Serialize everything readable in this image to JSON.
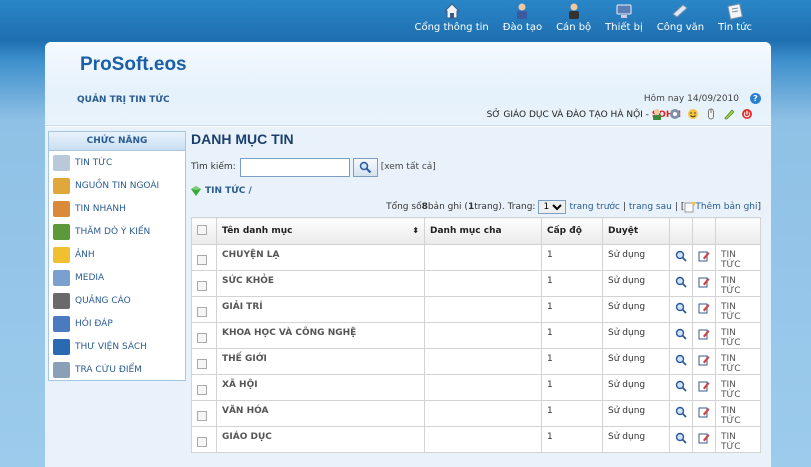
{
  "topnav": [
    {
      "label": "Cổng thông tin",
      "icon": "home-icon",
      "color": "#e8eef6"
    },
    {
      "label": "Đào tạo",
      "icon": "student-icon",
      "color": "#3d5aa0"
    },
    {
      "label": "Cán bộ",
      "icon": "staff-icon",
      "color": "#333333"
    },
    {
      "label": "Thiết bị",
      "icon": "device-icon",
      "color": "#5a7fb5"
    },
    {
      "label": "Công văn",
      "icon": "document-icon",
      "color": "#c9d6e6"
    },
    {
      "label": "Tin tức",
      "icon": "news-icon",
      "color": "#dfe6ee"
    }
  ],
  "header": {
    "logo": "ProSoft.eos",
    "subtitle": "QUẢN TRỊ TIN TỨC",
    "today": "Hôm nay 14/09/2010",
    "org": "SỞ GIÁO DỤC VÀ ĐÀO TẠO HÀ NỘI - ",
    "user": "SOHN"
  },
  "sidebar": {
    "title": "CHỨC NĂNG",
    "items": [
      {
        "label": "TIN TỨC",
        "icon": "news-icon",
        "color": "#b9c9d9"
      },
      {
        "label": "NGUỒN TIN NGOÀI",
        "icon": "external-source-icon",
        "color": "#e0a83a"
      },
      {
        "label": "TIN NHANH",
        "icon": "quick-news-icon",
        "color": "#d98b3a"
      },
      {
        "label": "THĂM DÒ Ý KIẾN",
        "icon": "poll-icon",
        "color": "#5a9a3a"
      },
      {
        "label": "ẢNH",
        "icon": "photo-folder-icon",
        "color": "#f0c030"
      },
      {
        "label": "MEDIA",
        "icon": "media-icon",
        "color": "#7aa0d0"
      },
      {
        "label": "QUẢNG CÁO",
        "icon": "advertising-icon",
        "color": "#6a6a6a"
      },
      {
        "label": "HỎI ĐÁP",
        "icon": "faq-icon",
        "color": "#4a7ac0"
      },
      {
        "label": "THƯ VIỆN SÁCH",
        "icon": "library-icon",
        "color": "#2a6ab0"
      },
      {
        "label": "TRA CỨU ĐIỂM",
        "icon": "lookup-icon",
        "color": "#8aa0b8"
      }
    ]
  },
  "main": {
    "title": "DANH MỤC TIN",
    "search_label": "Tìm kiếm:",
    "search_value": "",
    "see_all": "[xem tất cả]",
    "breadcrumb": "TIN TỨC /",
    "pager": {
      "prefix": "Tổng số ",
      "total": "8",
      "mid": " bản ghi (",
      "pages": "1",
      "suffix": " trang). Trang:",
      "current_page": "1",
      "prev": "trang trước",
      "next": "trang sau",
      "add_label": "Thêm bản ghi"
    },
    "columns": [
      "Tên danh mục",
      "Danh mục cha",
      "Cấp độ",
      "Duyệt"
    ],
    "rows": [
      {
        "name": "CHUYỆN LẠ",
        "parent": "",
        "level": "1",
        "status": "Sử dụng",
        "link": "TIN TỨC"
      },
      {
        "name": "SỨC KHỎE",
        "parent": "",
        "level": "1",
        "status": "Sử dụng",
        "link": "TIN TỨC"
      },
      {
        "name": "GIẢI TRÍ",
        "parent": "",
        "level": "1",
        "status": "Sử dụng",
        "link": "TIN TỨC"
      },
      {
        "name": "KHOA HỌC VÀ CÔNG NGHỆ",
        "parent": "",
        "level": "1",
        "status": "Sử dụng",
        "link": "TIN TỨC"
      },
      {
        "name": "THẾ GIỚI",
        "parent": "",
        "level": "1",
        "status": "Sử dụng",
        "link": "TIN TỨC"
      },
      {
        "name": "XÃ HỘI",
        "parent": "",
        "level": "1",
        "status": "Sử dụng",
        "link": "TIN TỨC"
      },
      {
        "name": "VĂN HÓA",
        "parent": "",
        "level": "1",
        "status": "Sử dụng",
        "link": "TIN TỨC"
      },
      {
        "name": "GIÁO DỤC",
        "parent": "",
        "level": "1",
        "status": "Sử dụng",
        "link": "TIN TỨC"
      }
    ]
  }
}
